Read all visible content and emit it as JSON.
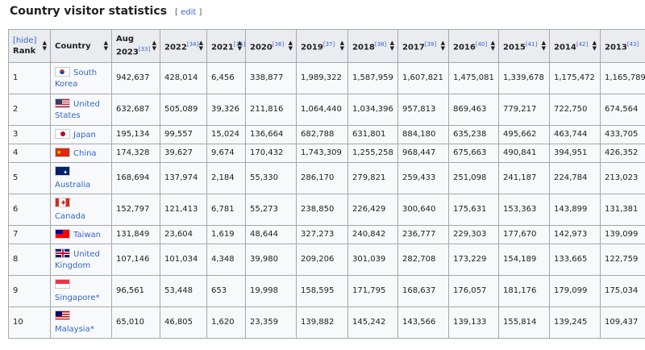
{
  "heading": {
    "title": "Country visitor statistics",
    "edit_label": "edit",
    "edit_open": "[",
    "edit_close": "]"
  },
  "table": {
    "hide_label": "[hide]",
    "sort_icon": "sort-arrows-icon",
    "columns": [
      {
        "label": "Rank",
        "ref": ""
      },
      {
        "label": "Country",
        "ref": ""
      },
      {
        "label": "Aug 2023",
        "ref": "[33]"
      },
      {
        "label": "2022",
        "ref": "[34]"
      },
      {
        "label": "2021",
        "ref": "[35]"
      },
      {
        "label": "2020",
        "ref": "[36]"
      },
      {
        "label": "2019",
        "ref": "[37]"
      },
      {
        "label": "2018",
        "ref": "[38]"
      },
      {
        "label": "2017",
        "ref": "[39]"
      },
      {
        "label": "2016",
        "ref": "[40]"
      },
      {
        "label": "2015",
        "ref": "[41]"
      },
      {
        "label": "2014",
        "ref": "[42]"
      },
      {
        "label": "2013",
        "ref": "[43]"
      }
    ],
    "rows": [
      {
        "rank": "1",
        "country": "South Korea",
        "flag": "kr",
        "values": [
          "942,637",
          "428,014",
          "6,456",
          "338,877",
          "1,989,322",
          "1,587,959",
          "1,607,821",
          "1,475,081",
          "1,339,678",
          "1,175,472",
          "1,165,789"
        ]
      },
      {
        "rank": "2",
        "country": "United States",
        "flag": "us",
        "values": [
          "632,687",
          "505,089",
          "39,326",
          "211,816",
          "1,064,440",
          "1,034,396",
          "957,813",
          "869,463",
          "779,217",
          "722,750",
          "674,564"
        ]
      },
      {
        "rank": "3",
        "country": "Japan",
        "flag": "jp",
        "values": [
          "195,134",
          "99,557",
          "15,024",
          "136,664",
          "682,788",
          "631,801",
          "884,180",
          "635,238",
          "495,662",
          "463,744",
          "433,705"
        ]
      },
      {
        "rank": "4",
        "country": "China",
        "flag": "cn",
        "values": [
          "174,328",
          "39,627",
          "9,674",
          "170,432",
          "1,743,309",
          "1,255,258",
          "968,447",
          "675,663",
          "490,841",
          "394,951",
          "426,352"
        ]
      },
      {
        "rank": "5",
        "country": "Australia",
        "flag": "au",
        "values": [
          "168,694",
          "137,974",
          "2,184",
          "55,330",
          "286,170",
          "279,821",
          "259,433",
          "251,098",
          "241,187",
          "224,784",
          "213,023"
        ]
      },
      {
        "rank": "6",
        "country": "Canada",
        "flag": "ca",
        "values": [
          "152,797",
          "121,413",
          "6,781",
          "55,273",
          "238,850",
          "226,429",
          "300,640",
          "175,631",
          "153,363",
          "143,899",
          "131,381"
        ]
      },
      {
        "rank": "7",
        "country": "Taiwan",
        "flag": "tw",
        "values": [
          "131,849",
          "23,604",
          "1,619",
          "48,644",
          "327,273",
          "240,842",
          "236,777",
          "229,303",
          "177,670",
          "142,973",
          "139,099"
        ]
      },
      {
        "rank": "8",
        "country": "United Kingdom",
        "flag": "gb",
        "values": [
          "107,146",
          "101,034",
          "4,348",
          "39,980",
          "209,206",
          "301,039",
          "282,708",
          "173,229",
          "154,189",
          "133,665",
          "122,759"
        ]
      },
      {
        "rank": "9",
        "country": "Singapore*",
        "flag": "sg",
        "values": [
          "96,561",
          "53,448",
          "653",
          "19,998",
          "158,595",
          "171,795",
          "168,637",
          "176,057",
          "181,176",
          "179,099",
          "175,034"
        ]
      },
      {
        "rank": "10",
        "country": "Malaysia*",
        "flag": "my",
        "values": [
          "65,010",
          "46,805",
          "1,620",
          "23,359",
          "139,882",
          "145,242",
          "143,566",
          "139,133",
          "155,814",
          "139,245",
          "109,437"
        ]
      }
    ]
  }
}
